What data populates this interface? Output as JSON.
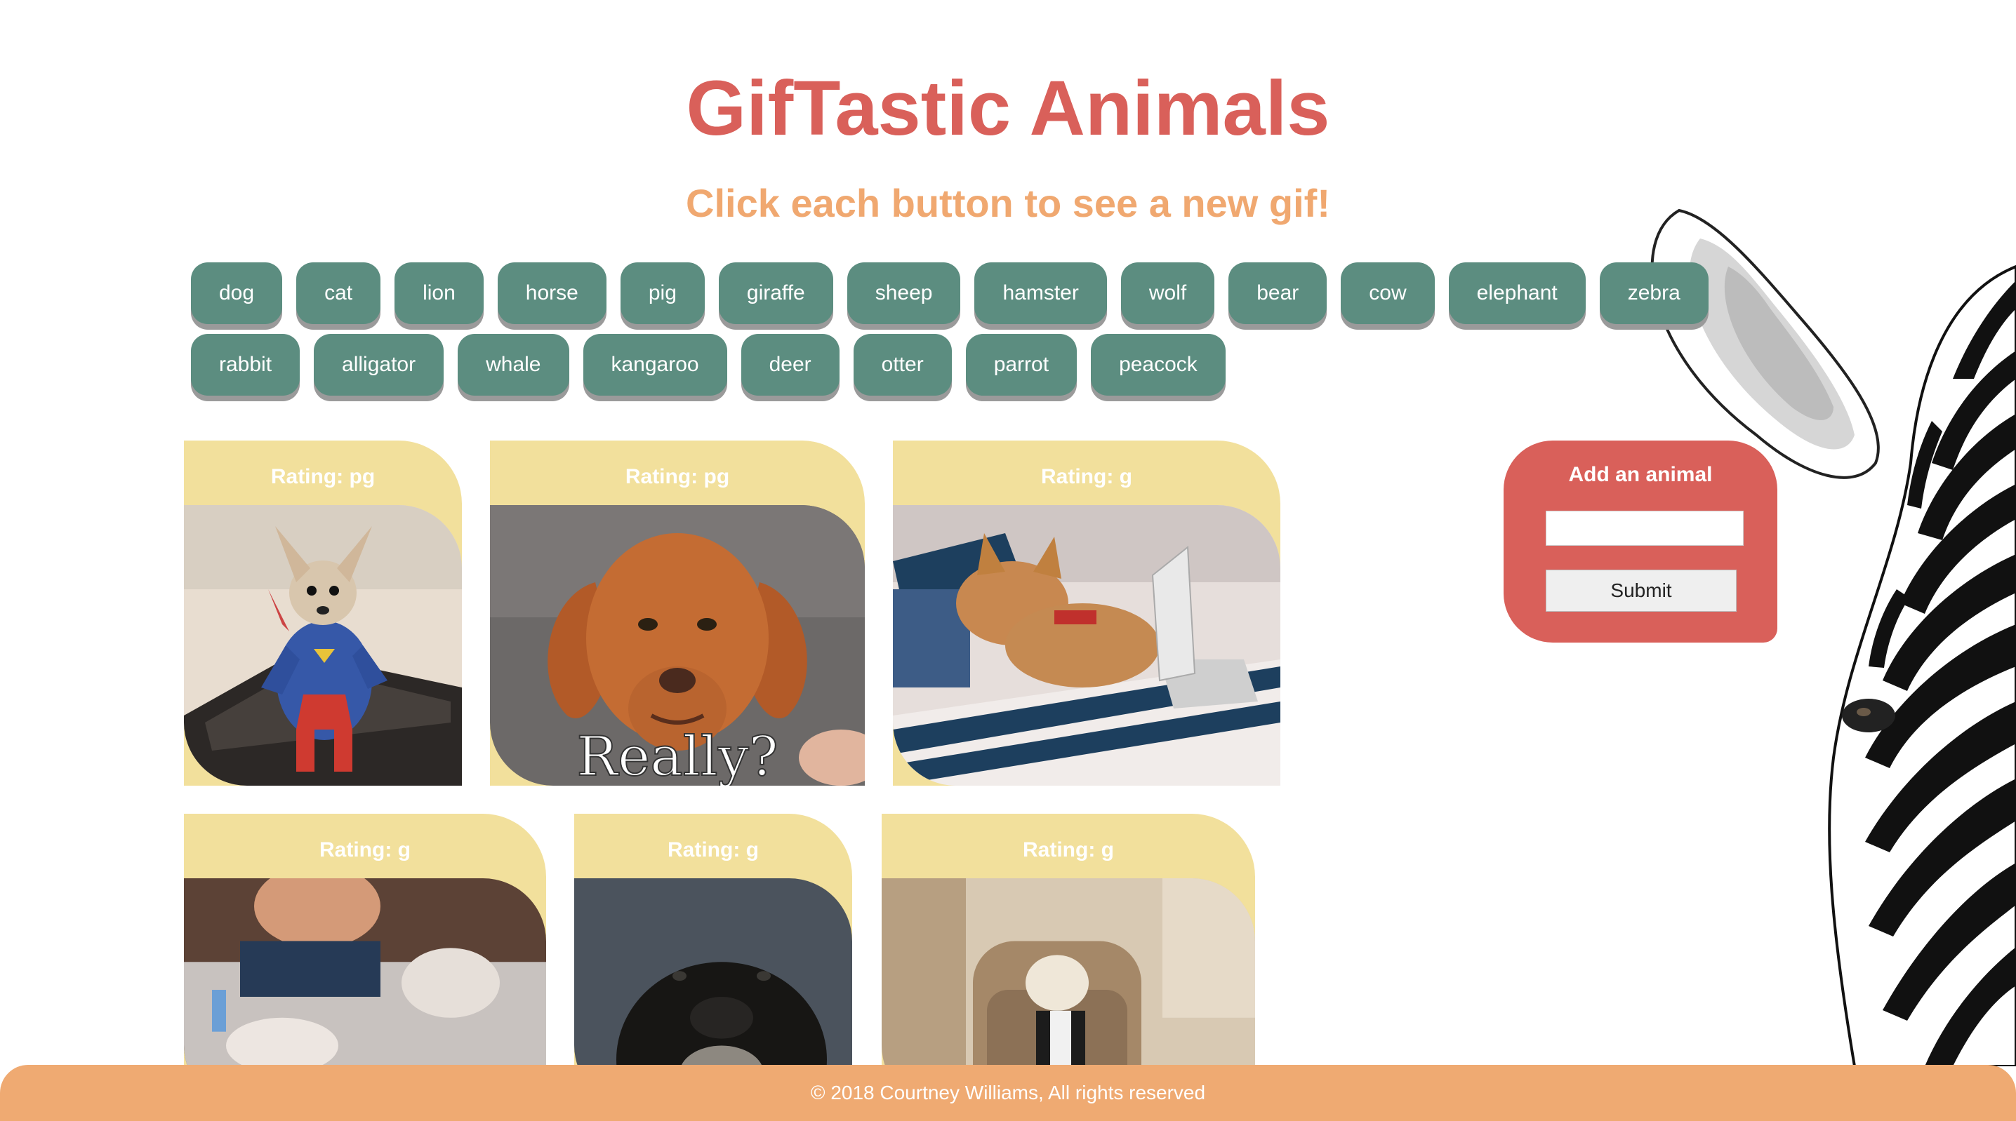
{
  "header": {
    "title": "GifTastic Animals",
    "subtitle": "Click each button to see a new gif!"
  },
  "animal_buttons": {
    "row1": [
      "dog",
      "cat",
      "lion",
      "horse",
      "pig",
      "giraffe",
      "sheep",
      "hamster",
      "wolf",
      "bear",
      "cow",
      "elephant",
      "zebra"
    ],
    "row2": [
      "rabbit",
      "alligator",
      "whale",
      "kangaroo",
      "deer",
      "otter",
      "parrot",
      "peacock"
    ]
  },
  "gifs": [
    {
      "rating": "Rating: pg",
      "subject": "chihuahua in superman costume on treadmill"
    },
    {
      "rating": "Rating: pg",
      "subject": "puppy with Really? caption",
      "caption": "Really?"
    },
    {
      "rating": "Rating: g",
      "subject": "shiba dog in bed with laptop"
    },
    {
      "rating": "Rating: g",
      "subject": "man washing dog in tub"
    },
    {
      "rating": "Rating: g",
      "subject": "black dog looking up"
    },
    {
      "rating": "Rating: g",
      "subject": "dog in tuxedo on armchair"
    }
  ],
  "add_form": {
    "title": "Add an animal",
    "input_value": "",
    "submit_label": "Submit"
  },
  "footer": {
    "text": "© 2018 Courtney Williams, All rights reserved"
  },
  "colors": {
    "title": "#d9605a",
    "subtitle": "#f0a870",
    "button": "#5c8d80",
    "card": "#f2e09c",
    "form": "#d9605a",
    "footer": "#efaa72"
  }
}
